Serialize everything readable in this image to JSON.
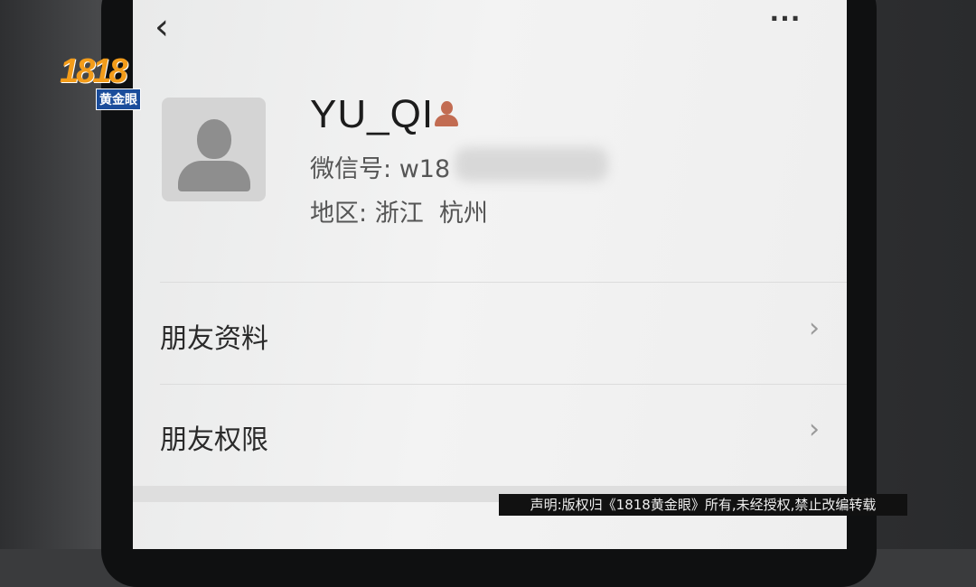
{
  "header": {
    "back_glyph": "‹",
    "more_glyph": "···"
  },
  "profile": {
    "name": "YU_QI",
    "wechat_id_label": "微信号:",
    "wechat_id_visible": "w18",
    "region_label": "地区:",
    "region_province": "浙江",
    "region_city": "杭州"
  },
  "menu": [
    {
      "label": "朋友资料",
      "chevron": "›"
    },
    {
      "label": "朋友权限",
      "chevron": "›"
    }
  ],
  "watermark": {
    "logo_number": "1818",
    "logo_text": "黄金眼"
  },
  "notice": "声明:版权归《1818黄金眼》所有,未经授权,禁止改编转载",
  "icons": {
    "avatar": "person-placeholder-icon",
    "gender": "female-person-icon",
    "back": "back-arrow-icon",
    "more": "more-dots-icon"
  }
}
